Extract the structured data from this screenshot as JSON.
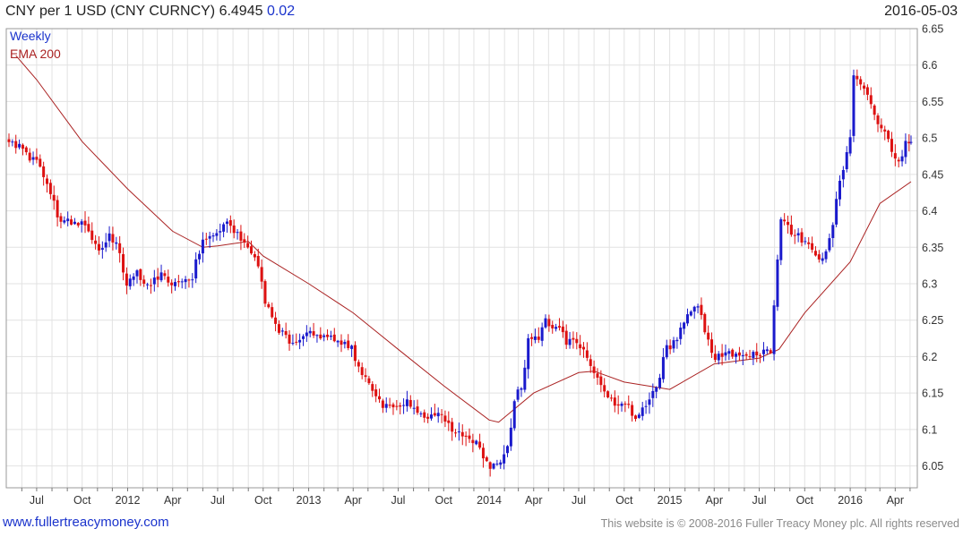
{
  "header": {
    "title": "CNY per 1 USD (CNY CURNCY) 6.4945",
    "change": "0.02",
    "date": "2016-05-03"
  },
  "footer": {
    "site": "www.fullertreacymoney.com",
    "copyright": "This website is © 2008-2016 Fuller Treacy Money plc. All rights reserved"
  },
  "colors": {
    "up": "#1a1acc",
    "down": "#dd1111",
    "ema": "#aa2222",
    "grid": "#e2e2e2",
    "legend_weekly": "#1a33cc",
    "legend_ema": "#aa2222"
  },
  "chart_data": {
    "type": "candlestick",
    "legend": [
      "Weekly",
      "EMA 200"
    ],
    "legend_position": "top-left",
    "y_axis": "right",
    "ylim": [
      6.02,
      6.65
    ],
    "yticks": [
      6.05,
      6.1,
      6.15,
      6.2,
      6.25,
      6.3,
      6.35,
      6.4,
      6.45,
      6.5,
      6.55,
      6.6,
      6.65
    ],
    "xlim": [
      "2011-05-06",
      "2016-05-03"
    ],
    "x_ticks": [
      {
        "date": "2011-07-01",
        "label": "Jul"
      },
      {
        "date": "2011-10-01",
        "label": "Oct"
      },
      {
        "date": "2012-01-01",
        "label": "2012"
      },
      {
        "date": "2012-04-01",
        "label": "Apr"
      },
      {
        "date": "2012-07-01",
        "label": "Jul"
      },
      {
        "date": "2012-10-01",
        "label": "Oct"
      },
      {
        "date": "2013-01-01",
        "label": "2013"
      },
      {
        "date": "2013-04-01",
        "label": "Apr"
      },
      {
        "date": "2013-07-01",
        "label": "Jul"
      },
      {
        "date": "2013-10-01",
        "label": "Oct"
      },
      {
        "date": "2014-01-01",
        "label": "2014"
      },
      {
        "date": "2014-04-01",
        "label": "Apr"
      },
      {
        "date": "2014-07-01",
        "label": "Jul"
      },
      {
        "date": "2014-10-01",
        "label": "Oct"
      },
      {
        "date": "2015-01-01",
        "label": "2015"
      },
      {
        "date": "2015-04-01",
        "label": "Apr"
      },
      {
        "date": "2015-07-01",
        "label": "Jul"
      },
      {
        "date": "2015-10-01",
        "label": "Oct"
      },
      {
        "date": "2016-01-01",
        "label": "2016"
      },
      {
        "date": "2016-04-01",
        "label": "Apr"
      }
    ],
    "close_anchors": [
      [
        "2011-05-06",
        6.496
      ],
      [
        "2011-05-20",
        6.49
      ],
      [
        "2011-06-10",
        6.478
      ],
      [
        "2011-07-01",
        6.465
      ],
      [
        "2011-07-22",
        6.44
      ],
      [
        "2011-08-12",
        6.395
      ],
      [
        "2011-08-26",
        6.386
      ],
      [
        "2011-09-16",
        6.387
      ],
      [
        "2011-10-07",
        6.378
      ],
      [
        "2011-10-21",
        6.36
      ],
      [
        "2011-11-04",
        6.345
      ],
      [
        "2011-11-25",
        6.367
      ],
      [
        "2011-12-09",
        6.355
      ],
      [
        "2011-12-30",
        6.302
      ],
      [
        "2012-01-20",
        6.315
      ],
      [
        "2012-02-10",
        6.3
      ],
      [
        "2012-03-09",
        6.31
      ],
      [
        "2012-03-30",
        6.295
      ],
      [
        "2012-04-20",
        6.308
      ],
      [
        "2012-05-11",
        6.31
      ],
      [
        "2012-06-01",
        6.365
      ],
      [
        "2012-06-22",
        6.362
      ],
      [
        "2012-07-13",
        6.385
      ],
      [
        "2012-07-27",
        6.38
      ],
      [
        "2012-08-17",
        6.36
      ],
      [
        "2012-09-07",
        6.345
      ],
      [
        "2012-09-21",
        6.32
      ],
      [
        "2012-10-05",
        6.276
      ],
      [
        "2012-10-19",
        6.25
      ],
      [
        "2012-11-09",
        6.23
      ],
      [
        "2012-11-30",
        6.218
      ],
      [
        "2012-12-28",
        6.232
      ],
      [
        "2013-01-25",
        6.224
      ],
      [
        "2013-02-15",
        6.226
      ],
      [
        "2013-03-08",
        6.218
      ],
      [
        "2013-03-29",
        6.21
      ],
      [
        "2013-04-19",
        6.18
      ],
      [
        "2013-05-10",
        6.15
      ],
      [
        "2013-05-31",
        6.134
      ],
      [
        "2013-06-21",
        6.132
      ],
      [
        "2013-07-19",
        6.136
      ],
      [
        "2013-08-09",
        6.125
      ],
      [
        "2013-08-30",
        6.119
      ],
      [
        "2013-09-20",
        6.12
      ],
      [
        "2013-10-11",
        6.11
      ],
      [
        "2013-10-25",
        6.09
      ],
      [
        "2013-11-15",
        6.095
      ],
      [
        "2013-12-06",
        6.08
      ],
      [
        "2013-12-27",
        6.055
      ],
      [
        "2014-01-10",
        6.048
      ],
      [
        "2014-01-24",
        6.06
      ],
      [
        "2014-02-07",
        6.075
      ],
      [
        "2014-02-21",
        6.14
      ],
      [
        "2014-03-07",
        6.16
      ],
      [
        "2014-03-21",
        6.22
      ],
      [
        "2014-04-11",
        6.225
      ],
      [
        "2014-04-25",
        6.252
      ],
      [
        "2014-05-09",
        6.233
      ],
      [
        "2014-05-23",
        6.24
      ],
      [
        "2014-06-06",
        6.22
      ],
      [
        "2014-06-20",
        6.22
      ],
      [
        "2014-07-11",
        6.205
      ],
      [
        "2014-08-01",
        6.175
      ],
      [
        "2014-08-22",
        6.15
      ],
      [
        "2014-09-12",
        6.138
      ],
      [
        "2014-10-03",
        6.135
      ],
      [
        "2014-10-24",
        6.115
      ],
      [
        "2014-11-14",
        6.13
      ],
      [
        "2014-12-05",
        6.16
      ],
      [
        "2014-12-26",
        6.21
      ],
      [
        "2015-01-16",
        6.225
      ],
      [
        "2015-01-30",
        6.25
      ],
      [
        "2015-02-13",
        6.265
      ],
      [
        "2015-02-27",
        6.27
      ],
      [
        "2015-03-13",
        6.235
      ],
      [
        "2015-03-27",
        6.2
      ],
      [
        "2015-04-10",
        6.198
      ],
      [
        "2015-04-24",
        6.205
      ],
      [
        "2015-05-15",
        6.205
      ],
      [
        "2015-06-05",
        6.202
      ],
      [
        "2015-06-26",
        6.205
      ],
      [
        "2015-07-24",
        6.21
      ],
      [
        "2015-08-14",
        6.39
      ],
      [
        "2015-09-04",
        6.37
      ],
      [
        "2015-09-25",
        6.362
      ],
      [
        "2015-10-16",
        6.35
      ],
      [
        "2015-11-06",
        6.33
      ],
      [
        "2015-11-27",
        6.385
      ],
      [
        "2015-12-11",
        6.44
      ],
      [
        "2015-12-31",
        6.495
      ],
      [
        "2016-01-08",
        6.58
      ],
      [
        "2016-01-29",
        6.57
      ],
      [
        "2016-02-19",
        6.53
      ],
      [
        "2016-03-11",
        6.51
      ],
      [
        "2016-03-25",
        6.48
      ],
      [
        "2016-04-08",
        6.47
      ],
      [
        "2016-04-22",
        6.49
      ],
      [
        "2016-05-03",
        6.4945
      ]
    ],
    "ema_anchors": [
      [
        "2011-05-20",
        6.613
      ],
      [
        "2011-07-01",
        6.58
      ],
      [
        "2011-10-01",
        6.495
      ],
      [
        "2012-01-01",
        6.43
      ],
      [
        "2012-04-01",
        6.372
      ],
      [
        "2012-06-01",
        6.35
      ],
      [
        "2012-07-01",
        6.352
      ],
      [
        "2012-09-01",
        6.358
      ],
      [
        "2012-10-01",
        6.338
      ],
      [
        "2013-01-01",
        6.3
      ],
      [
        "2013-04-01",
        6.26
      ],
      [
        "2013-07-01",
        6.21
      ],
      [
        "2013-10-01",
        6.16
      ],
      [
        "2014-01-01",
        6.113
      ],
      [
        "2014-01-20",
        6.11
      ],
      [
        "2014-04-01",
        6.15
      ],
      [
        "2014-07-01",
        6.178
      ],
      [
        "2014-08-01",
        6.18
      ],
      [
        "2014-10-01",
        6.165
      ],
      [
        "2015-01-01",
        6.155
      ],
      [
        "2015-04-01",
        6.19
      ],
      [
        "2015-07-01",
        6.198
      ],
      [
        "2015-08-10",
        6.21
      ],
      [
        "2015-10-01",
        6.26
      ],
      [
        "2016-01-01",
        6.33
      ],
      [
        "2016-03-01",
        6.41
      ],
      [
        "2016-05-03",
        6.44
      ]
    ]
  }
}
